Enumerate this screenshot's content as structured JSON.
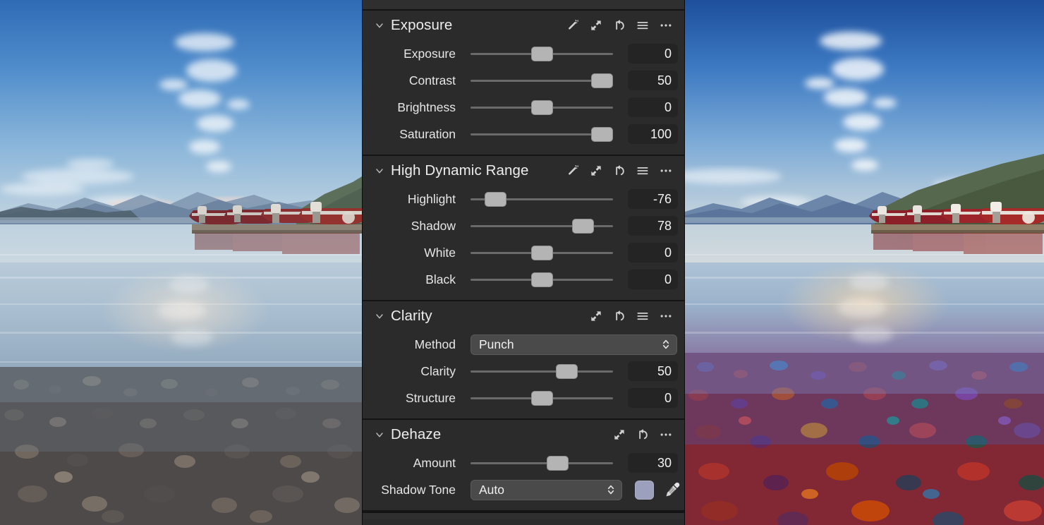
{
  "app": {
    "panel_name": "Adjustments Inspector",
    "photo_description": "Lake McDonald with moored boats and colorful pebbles, split before/after preview"
  },
  "sections": [
    {
      "id": "exposure",
      "title": "Exposure",
      "collapse_icon": "chevron-down-icon",
      "icons": [
        "auto-wand-icon",
        "expand-icon",
        "reset-icon",
        "menu-icon",
        "more-icon"
      ],
      "rows": [
        {
          "label": "Exposure",
          "value": "0",
          "percent": 50
        },
        {
          "label": "Contrast",
          "value": "50",
          "percent": 94
        },
        {
          "label": "Brightness",
          "value": "0",
          "percent": 50
        },
        {
          "label": "Saturation",
          "value": "100",
          "percent": 94
        }
      ]
    },
    {
      "id": "high-dynamic-range",
      "title": "High Dynamic Range",
      "collapse_icon": "chevron-down-icon",
      "icons": [
        "auto-wand-icon",
        "expand-icon",
        "reset-icon",
        "menu-icon",
        "more-icon"
      ],
      "rows": [
        {
          "label": "Highlight",
          "value": "-76",
          "percent": 12
        },
        {
          "label": "Shadow",
          "value": "78",
          "percent": 84
        },
        {
          "label": "White",
          "value": "0",
          "percent": 50
        },
        {
          "label": "Black",
          "value": "0",
          "percent": 50
        }
      ]
    },
    {
      "id": "clarity",
      "title": "Clarity",
      "collapse_icon": "chevron-down-icon",
      "icons": [
        "expand-icon",
        "reset-icon",
        "menu-icon",
        "more-icon"
      ],
      "method": {
        "label": "Method",
        "value": "Punch",
        "stepper_icon": "stepper-icon"
      },
      "rows": [
        {
          "label": "Clarity",
          "value": "50",
          "percent": 71
        },
        {
          "label": "Structure",
          "value": "0",
          "percent": 50
        }
      ]
    },
    {
      "id": "dehaze",
      "title": "Dehaze",
      "collapse_icon": "chevron-down-icon",
      "icons": [
        "expand-icon",
        "reset-icon",
        "more-icon"
      ],
      "rows": [
        {
          "label": "Amount",
          "value": "30",
          "percent": 63
        }
      ],
      "shadow_tone": {
        "label": "Shadow Tone",
        "value": "Auto",
        "stepper_icon": "stepper-icon",
        "swatch_color": "#9ca0bc",
        "picker_icon": "eyedropper-icon"
      }
    }
  ],
  "colors": {
    "panel_bg": "#2b2b2b",
    "divider": "#141414",
    "track": "#6a6a6a",
    "thumb": "#b4b4b4",
    "field_bg": "#242424",
    "dropdown_bg": "#4a4a4a",
    "text": "#ededed"
  }
}
